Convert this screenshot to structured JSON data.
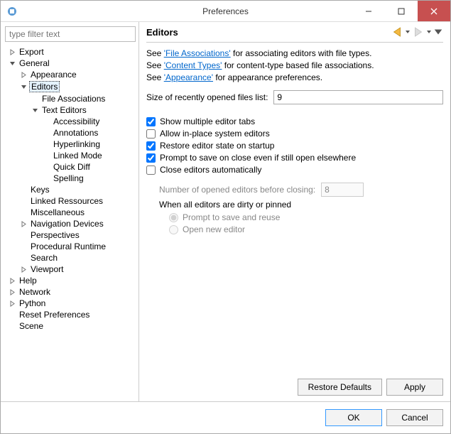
{
  "window": {
    "title": "Preferences"
  },
  "sidebar": {
    "filter_placeholder": "type filter text",
    "nodes": [
      {
        "label": "Export",
        "depth": 0,
        "expand": "closed"
      },
      {
        "label": "General",
        "depth": 0,
        "expand": "open"
      },
      {
        "label": "Appearance",
        "depth": 1,
        "expand": "closed"
      },
      {
        "label": "Editors",
        "depth": 1,
        "expand": "open",
        "selected": true
      },
      {
        "label": "File Associations",
        "depth": 2,
        "expand": "none"
      },
      {
        "label": "Text Editors",
        "depth": 2,
        "expand": "open"
      },
      {
        "label": "Accessibility",
        "depth": 3,
        "expand": "none"
      },
      {
        "label": "Annotations",
        "depth": 3,
        "expand": "none"
      },
      {
        "label": "Hyperlinking",
        "depth": 3,
        "expand": "none"
      },
      {
        "label": "Linked Mode",
        "depth": 3,
        "expand": "none"
      },
      {
        "label": "Quick Diff",
        "depth": 3,
        "expand": "none"
      },
      {
        "label": "Spelling",
        "depth": 3,
        "expand": "none"
      },
      {
        "label": "Keys",
        "depth": 1,
        "expand": "none"
      },
      {
        "label": "Linked Ressources",
        "depth": 1,
        "expand": "none"
      },
      {
        "label": "Miscellaneous",
        "depth": 1,
        "expand": "none"
      },
      {
        "label": "Navigation Devices",
        "depth": 1,
        "expand": "closed"
      },
      {
        "label": "Perspectives",
        "depth": 1,
        "expand": "none"
      },
      {
        "label": "Procedural Runtime",
        "depth": 1,
        "expand": "none"
      },
      {
        "label": "Search",
        "depth": 1,
        "expand": "none"
      },
      {
        "label": "Viewport",
        "depth": 1,
        "expand": "closed"
      },
      {
        "label": "Help",
        "depth": 0,
        "expand": "closed"
      },
      {
        "label": "Network",
        "depth": 0,
        "expand": "closed"
      },
      {
        "label": "Python",
        "depth": 0,
        "expand": "closed"
      },
      {
        "label": "Reset Preferences",
        "depth": 0,
        "expand": "none"
      },
      {
        "label": "Scene",
        "depth": 0,
        "expand": "none"
      }
    ]
  },
  "main": {
    "heading": "Editors",
    "see1_pre": "See ",
    "see1_link": "'File Associations'",
    "see1_post": " for associating editors with file types.",
    "see2_pre": "See ",
    "see2_link": "'Content Types'",
    "see2_post": " for content-type based file associations.",
    "see3_pre": "See ",
    "see3_link": "'Appearance'",
    "see3_post": " for appearance preferences.",
    "recent_label": "Size of recently opened files list:",
    "recent_value": "9",
    "checks": [
      {
        "label": "Show multiple editor tabs",
        "checked": true
      },
      {
        "label": "Allow in-place system editors",
        "checked": false
      },
      {
        "label": "Restore editor state on startup",
        "checked": true
      },
      {
        "label": "Prompt to save on close even if still open elsewhere",
        "checked": true
      },
      {
        "label": "Close editors automatically",
        "checked": false
      }
    ],
    "num_label": "Number of opened editors before closing:",
    "num_value": "8",
    "group_label": "When all editors are dirty or pinned",
    "radios": [
      {
        "label": "Prompt to save and reuse",
        "checked": true
      },
      {
        "label": "Open new editor",
        "checked": false
      }
    ],
    "restore": "Restore Defaults",
    "apply": "Apply"
  },
  "footer": {
    "ok": "OK",
    "cancel": "Cancel"
  }
}
